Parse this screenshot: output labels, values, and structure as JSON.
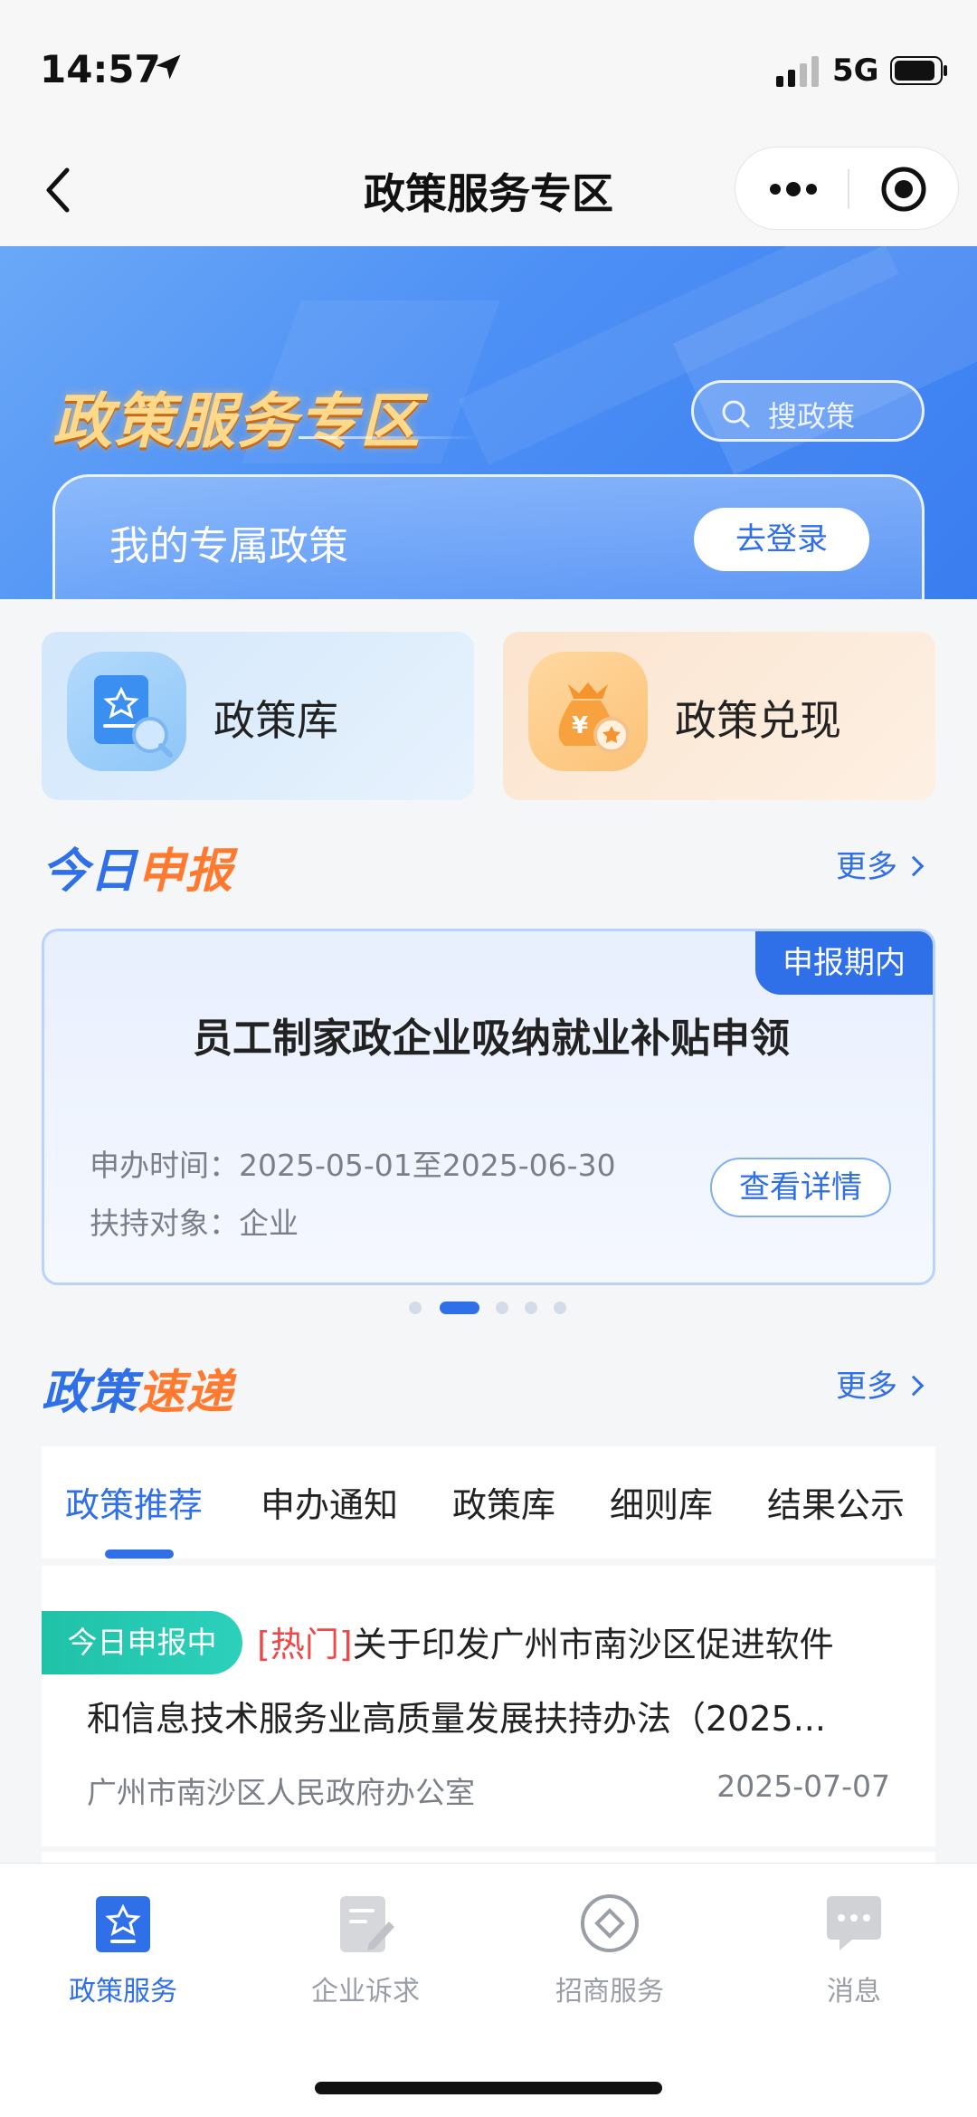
{
  "status_bar": {
    "time": "14:57",
    "network": "5G"
  },
  "nav": {
    "title": "政策服务专区"
  },
  "banner": {
    "title": "政策服务专区",
    "search_placeholder": "搜政策",
    "my_policy_label": "我的专属政策",
    "login_button": "去登录"
  },
  "quick_cards": [
    {
      "label": "政策库",
      "icon": "policy-library-icon"
    },
    {
      "label": "政策兑现",
      "icon": "money-bag-icon"
    }
  ],
  "today_section": {
    "title_part1": "今日",
    "title_part2": "申报",
    "more": "更多"
  },
  "declaration": {
    "badge": "申报期内",
    "title": "员工制家政企业吸纳就业补贴申领",
    "time_label": "申办时间：",
    "time_value": "2025-05-01至2025-06-30",
    "target_label": "扶持对象：",
    "target_value": "企业",
    "detail_button": "查看详情"
  },
  "carousel": {
    "count": 5,
    "active_index": 1
  },
  "express_section": {
    "title_part1": "政策",
    "title_part2": "速递",
    "more": "更多"
  },
  "tabs": [
    {
      "label": "政策推荐",
      "active": true
    },
    {
      "label": "申办通知",
      "active": false
    },
    {
      "label": "政策库",
      "active": false
    },
    {
      "label": "细则库",
      "active": false
    },
    {
      "label": "结果公示",
      "active": false
    }
  ],
  "policy_item": {
    "badge": "今日申报中",
    "hot_tag": "[热门]",
    "title_line1": "关于印发广州市南沙区促进软件",
    "title_line2": "和信息技术服务业高质量发展扶持办法（2025...",
    "source": "广州市南沙区人民政府办公室",
    "date": "2025-07-07"
  },
  "bottom_tabs": [
    {
      "label": "政策服务",
      "icon": "policy-service-icon",
      "active": true
    },
    {
      "label": "企业诉求",
      "icon": "enterprise-request-icon",
      "active": false
    },
    {
      "label": "招商服务",
      "icon": "investment-service-icon",
      "active": false
    },
    {
      "label": "消息",
      "icon": "message-icon",
      "active": false
    }
  ],
  "colors": {
    "primary": "#2f6fe8",
    "accent_orange": "#ff7a2f",
    "hot_red": "#f04848",
    "badge_green": "#1fc2a7"
  }
}
